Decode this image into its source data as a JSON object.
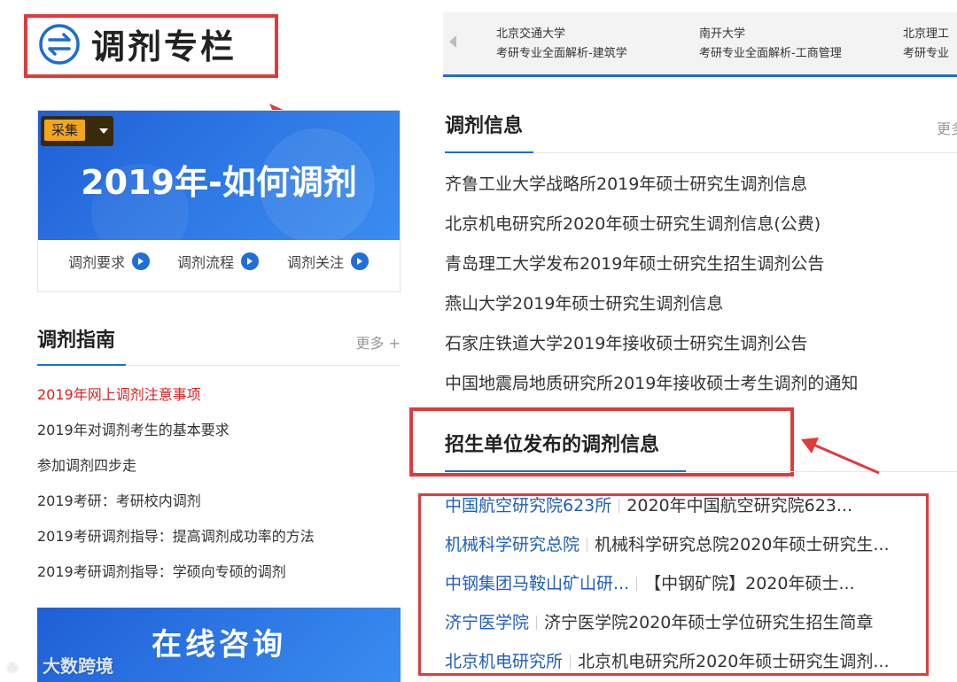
{
  "header": {
    "logo_text": "调剂专栏",
    "carousel": [
      {
        "line1": "北京交通大学",
        "line2": "考研专业全面解析-建筑学"
      },
      {
        "line1": "南开大学",
        "line2": "考研专业全面解析-工商管理"
      },
      {
        "line1": "北京理工",
        "line2": "考研专业"
      }
    ]
  },
  "promo": {
    "collect_label": "采集",
    "title": "2019年-如何调剂",
    "links": [
      "调剂要求",
      "调剂流程",
      "调剂关注"
    ]
  },
  "guide": {
    "title": "调剂指南",
    "more": "更多 +",
    "items": [
      "2019年网上调剂注意事项",
      "2019年对调剂考生的基本要求",
      "参加调剂四步走",
      "2019考研：考研校内调剂",
      "2019考研调剂指导：提高调剂成功率的方法",
      "2019考研调剂指导：学硕向专硕的调剂"
    ]
  },
  "consult": {
    "text": "在线咨询"
  },
  "watermark": {
    "text": "大数跨境"
  },
  "info": {
    "title": "调剂信息",
    "more": "更多",
    "items": [
      "齐鲁工业大学战略所2019年硕士研究生调剂信息",
      "北京机电研究所2020年硕士研究生调剂信息(公费)",
      "青岛理工大学发布2019年硕士研究生招生调剂公告",
      "燕山大学2019年硕士研究生调剂信息",
      "石家庄铁道大学2019年接收硕士研究生调剂公告",
      "中国地震局地质研究所2019年接收硕士考生调剂的通知"
    ]
  },
  "publish": {
    "title": "招生单位发布的调剂信息",
    "items": [
      {
        "org": "中国航空研究院623所",
        "text": "2020年中国航空研究院623..."
      },
      {
        "org": "机械科学研究总院",
        "text": "机械科学研究总院2020年硕士研究生..."
      },
      {
        "org": "中钢集团马鞍山矿山研...",
        "text": "【中钢矿院】2020年硕士..."
      },
      {
        "org": "济宁医学院",
        "text": "济宁医学院2020年硕士学位研究生招生简章"
      },
      {
        "org": "北京机电研究所",
        "text": "北京机电研究所2020年硕士研究生调剂..."
      }
    ]
  },
  "colors": {
    "accent_blue": "#1b6fd1",
    "highlight_red": "#e03b3b",
    "link_blue": "#1f5fb8",
    "hot_red": "#e02020"
  }
}
